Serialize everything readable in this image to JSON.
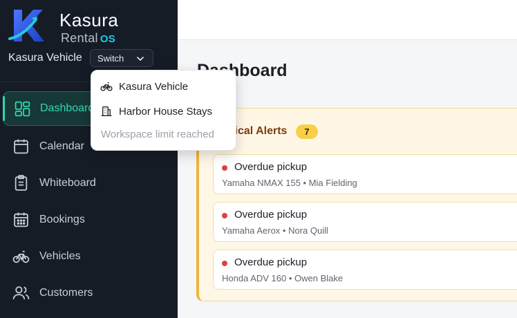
{
  "brand": {
    "title": "Kasura",
    "sub_word": "Rental",
    "sub_badge": "OS"
  },
  "workspace": {
    "current": "Kasura Vehicle",
    "switch_label": "Switch"
  },
  "nav": {
    "items": [
      {
        "label": "Dashboard",
        "icon": "dashboard-icon",
        "active": true
      },
      {
        "label": "Calendar",
        "icon": "calendar-icon"
      },
      {
        "label": "Whiteboard",
        "icon": "clipboard-icon"
      },
      {
        "label": "Bookings",
        "icon": "bookings-calendar-icon"
      },
      {
        "label": "Vehicles",
        "icon": "bicycle-icon"
      },
      {
        "label": "Customers",
        "icon": "users-icon"
      }
    ]
  },
  "dropdown": {
    "items": [
      {
        "label": "Kasura Vehicle",
        "icon": "bicycle-icon"
      },
      {
        "label": "Harbor House Stays",
        "icon": "building-icon"
      }
    ],
    "note": "Workspace limit reached"
  },
  "main": {
    "title": "Dashboard"
  },
  "alerts": {
    "title": "Critical Alerts",
    "count": "7",
    "items": [
      {
        "title": "Overdue pickup",
        "detail": "Yamaha NMAX 155 • Mia Fielding"
      },
      {
        "title": "Overdue pickup",
        "detail": "Yamaha Aerox • Nora Quill"
      },
      {
        "title": "Overdue pickup",
        "detail": "Honda ADV 160 • Owen Blake"
      }
    ]
  },
  "colors": {
    "sidebar_bg": "#161c26",
    "accent": "#2fd8b2",
    "alert_border": "#f0b43c",
    "alert_dot": "#e0403f",
    "badge": "#f9cf4a"
  }
}
